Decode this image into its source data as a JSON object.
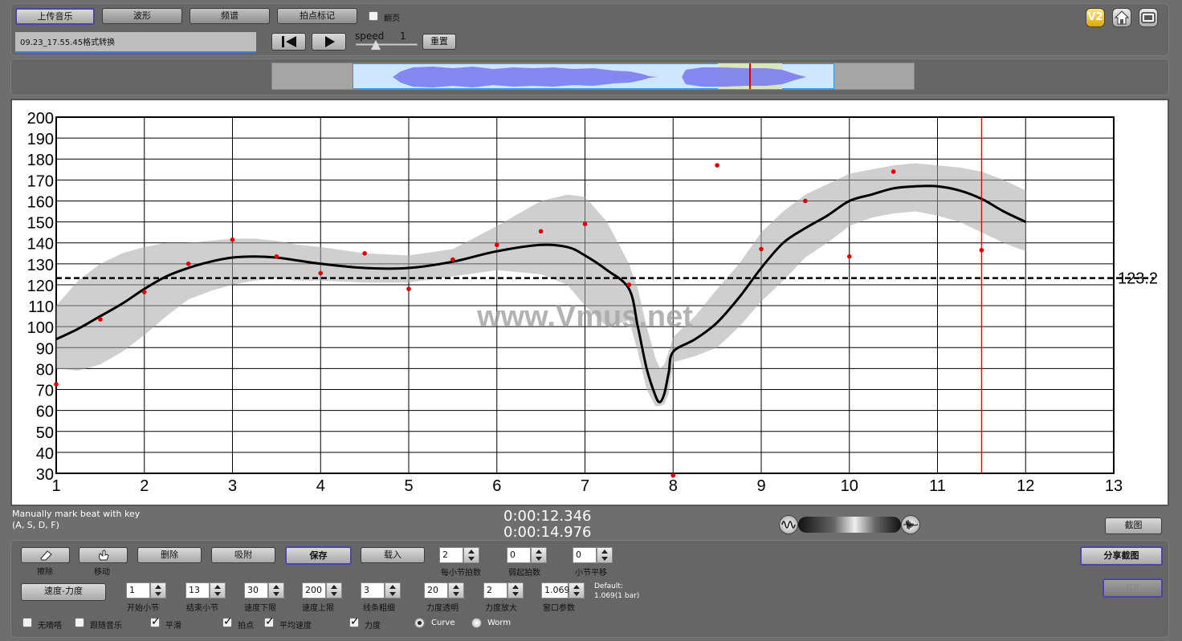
{
  "top": {
    "upload_label": "上传音乐",
    "waveform_label": "波形",
    "spectrum_label": "频谱",
    "beat_mark_label": "拍点标记",
    "page_turn_label": "翻页",
    "filename": "09.23_17.55.45格式转换",
    "speed_label": "speed",
    "speed_value": "1",
    "reset_label": "重置",
    "version_badge": "V2"
  },
  "chart_data": {
    "type": "line",
    "xlim": [
      1,
      13
    ],
    "ylim": [
      30,
      200
    ],
    "x_ticks": [
      "1",
      "2",
      "3",
      "4",
      "5",
      "6",
      "7",
      "8",
      "9",
      "10",
      "11",
      "12",
      "13"
    ],
    "y_ticks": [
      "30",
      "40",
      "50",
      "60",
      "70",
      "80",
      "90",
      "100",
      "110",
      "120",
      "130",
      "140",
      "150",
      "160",
      "170",
      "180",
      "190",
      "200"
    ],
    "average_label": "123.2",
    "average_value": 123.2,
    "cursor_x": 11.5,
    "watermark": "www.Vmus.net",
    "curve_x": [
      1,
      1.25,
      1.5,
      1.75,
      2,
      2.25,
      2.5,
      2.75,
      3,
      3.25,
      3.5,
      3.75,
      4,
      4.5,
      5,
      5.5,
      6,
      6.5,
      6.8,
      7,
      7.25,
      7.5,
      7.6,
      7.7,
      7.8,
      7.85,
      7.9,
      7.95,
      8,
      8.25,
      8.5,
      8.75,
      9,
      9.25,
      9.5,
      9.75,
      10,
      10.25,
      10.5,
      10.75,
      11,
      11.25,
      11.5,
      11.75,
      12
    ],
    "curve_y": [
      94,
      99,
      105,
      111,
      118,
      124,
      128,
      131,
      133,
      133.5,
      133,
      131.5,
      130,
      128,
      128,
      131,
      136,
      139,
      138,
      134,
      127,
      118,
      100,
      80,
      67,
      64,
      68,
      78,
      88,
      94,
      102,
      114,
      128,
      140,
      147,
      153,
      160,
      163,
      166,
      167,
      167,
      165,
      161,
      155,
      150
    ],
    "band_upper": [
      110,
      122,
      130,
      135,
      138,
      140,
      140,
      141,
      142,
      142,
      141,
      139,
      138,
      135,
      134,
      137,
      148,
      160,
      163,
      162,
      150,
      130,
      118,
      100,
      85,
      80,
      82,
      88,
      95,
      105,
      118,
      130,
      145,
      155,
      163,
      168,
      173,
      175,
      177,
      178,
      177,
      176,
      174,
      170,
      165
    ],
    "band_lower": [
      80,
      79,
      82,
      88,
      96,
      105,
      113,
      117,
      120,
      122,
      123,
      122,
      122,
      121,
      121,
      124,
      127,
      125,
      120,
      110,
      100,
      103,
      88,
      70,
      62,
      62,
      63,
      68,
      83,
      86,
      90,
      100,
      112,
      122,
      133,
      140,
      148,
      152,
      154,
      155,
      153,
      150,
      145,
      140,
      136
    ],
    "beats": [
      {
        "x": 1,
        "y": 72.5
      },
      {
        "x": 1.5,
        "y": 103.5
      },
      {
        "x": 2,
        "y": 116.5
      },
      {
        "x": 2.5,
        "y": 130
      },
      {
        "x": 3,
        "y": 141.5
      },
      {
        "x": 3.5,
        "y": 133.5
      },
      {
        "x": 4,
        "y": 125.5
      },
      {
        "x": 4.5,
        "y": 135
      },
      {
        "x": 5,
        "y": 118
      },
      {
        "x": 5.5,
        "y": 132
      },
      {
        "x": 6,
        "y": 139
      },
      {
        "x": 6.5,
        "y": 145.5
      },
      {
        "x": 7,
        "y": 149
      },
      {
        "x": 7.5,
        "y": 120
      },
      {
        "x": 8,
        "y": 29
      },
      {
        "x": 8.5,
        "y": 177
      },
      {
        "x": 9,
        "y": 137
      },
      {
        "x": 9.5,
        "y": 160
      },
      {
        "x": 10,
        "y": 133.5
      },
      {
        "x": 10.5,
        "y": 174
      },
      {
        "x": 11.5,
        "y": 136.5
      }
    ]
  },
  "info": {
    "hint_line1": "Manually mark beat with key",
    "hint_line2": "(A, S, D, F)",
    "time_current": "0:00:12.346",
    "time_total": "0:00:14.976",
    "screenshot_label": "截图"
  },
  "tools": {
    "erase_label": "擦除",
    "move_label": "移动",
    "delete_label": "删除",
    "snap_label": "吸附",
    "save_label": "保存",
    "load_label": "载入",
    "beats_per_bar_label": "每小节拍数",
    "beats_per_bar": "2",
    "weak_beats_label": "弱起拍数",
    "weak_beats": "0",
    "bar_shift_label": "小节平移",
    "bar_shift": "0",
    "share_label": "分享截图",
    "ioi_label": "IOI",
    "tempo_dynamics_label": "速度-力度",
    "start_bar_label": "开始小节",
    "start_bar": "1",
    "end_bar_label": "结束小节",
    "end_bar": "13",
    "tempo_min_label": "速度下限",
    "tempo_min": "30",
    "tempo_max_label": "速度上限",
    "tempo_max": "200",
    "line_width_label": "线条粗细",
    "line_width": "3",
    "dyn_opacity_label": "力度透明",
    "dyn_opacity": "20",
    "dyn_scale_label": "力度放大",
    "dyn_scale": "2",
    "window_label": "窗口参数",
    "window": "1.069",
    "default_line1": "Default:",
    "default_line2": "1.069(1 bar)",
    "no_beat_label": "无嘀嗒",
    "follow_music_label": "跟随音乐",
    "smooth_label": "平滑",
    "beat_points_label": "拍点",
    "avg_tempo_label": "平均速度",
    "dynamics_label": "力度",
    "curve_label": "Curve",
    "worm_label": "Worm"
  }
}
